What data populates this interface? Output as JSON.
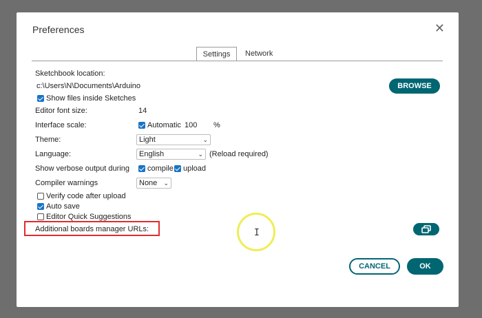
{
  "dialog": {
    "title": "Preferences",
    "close_glyph": "✕"
  },
  "tabs": [
    {
      "label": "Settings",
      "active": true
    },
    {
      "label": "Network",
      "active": false
    }
  ],
  "settings": {
    "sketchbook_label": "Sketchbook location:",
    "sketchbook_value": "c:\\Users\\N\\Documents\\Arduino",
    "browse_label": "BROWSE",
    "show_files_label": "Show files inside Sketches",
    "show_files_checked": true,
    "font_size_label": "Editor font size:",
    "font_size_value": "14",
    "scale_label": "Interface scale:",
    "scale_auto_label": "Automatic",
    "scale_auto_checked": true,
    "scale_value": "100",
    "scale_unit": "%",
    "theme_label": "Theme:",
    "theme_value": "Light",
    "language_label": "Language:",
    "language_value": "English",
    "language_note": "(Reload required)",
    "verbose_label": "Show verbose output during",
    "verbose_compile_label": "compile",
    "verbose_compile_checked": true,
    "verbose_upload_label": "upload",
    "verbose_upload_checked": true,
    "warnings_label": "Compiler warnings",
    "warnings_value": "None",
    "verify_label": "Verify code after upload",
    "verify_checked": false,
    "autosave_label": "Auto save",
    "autosave_checked": true,
    "quick_suggest_label": "Editor Quick Suggestions",
    "quick_suggest_checked": false,
    "boards_url_label": "Additional boards manager URLs:",
    "boards_url_value": ""
  },
  "footer": {
    "cancel_label": "CANCEL",
    "ok_label": "OK"
  },
  "icons": {
    "chevron": "⌄",
    "ibeam": "I"
  },
  "colors": {
    "accent": "#006672",
    "highlight": "#e22b2b",
    "checkbox": "#1a74c4"
  }
}
